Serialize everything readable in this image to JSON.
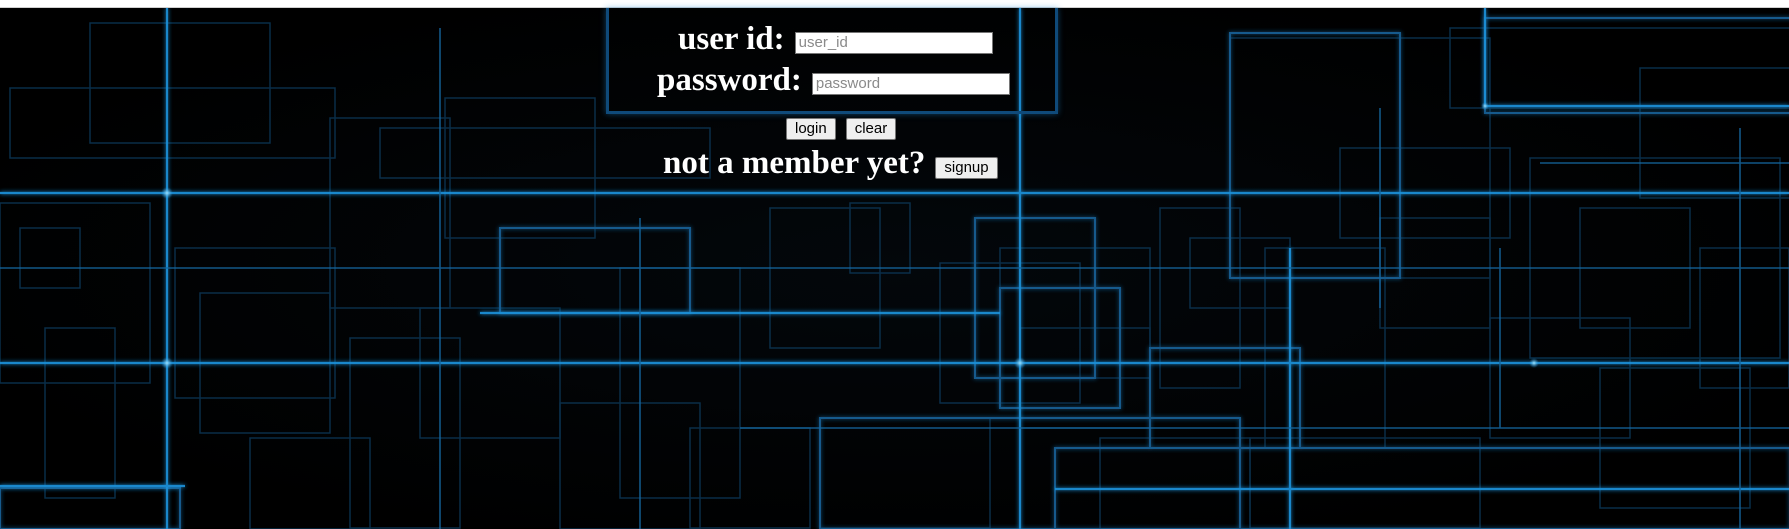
{
  "login_form": {
    "user_id_label": "user id:",
    "user_id_placeholder": "user_id",
    "password_label": "password:",
    "password_placeholder": "password",
    "login_button": "login",
    "clear_button": "clear"
  },
  "signup": {
    "prompt": "not a member yet?",
    "button": "signup"
  },
  "colors": {
    "background": "#000000",
    "grid_lines": "#1e8fd6",
    "text": "#ffffff"
  }
}
